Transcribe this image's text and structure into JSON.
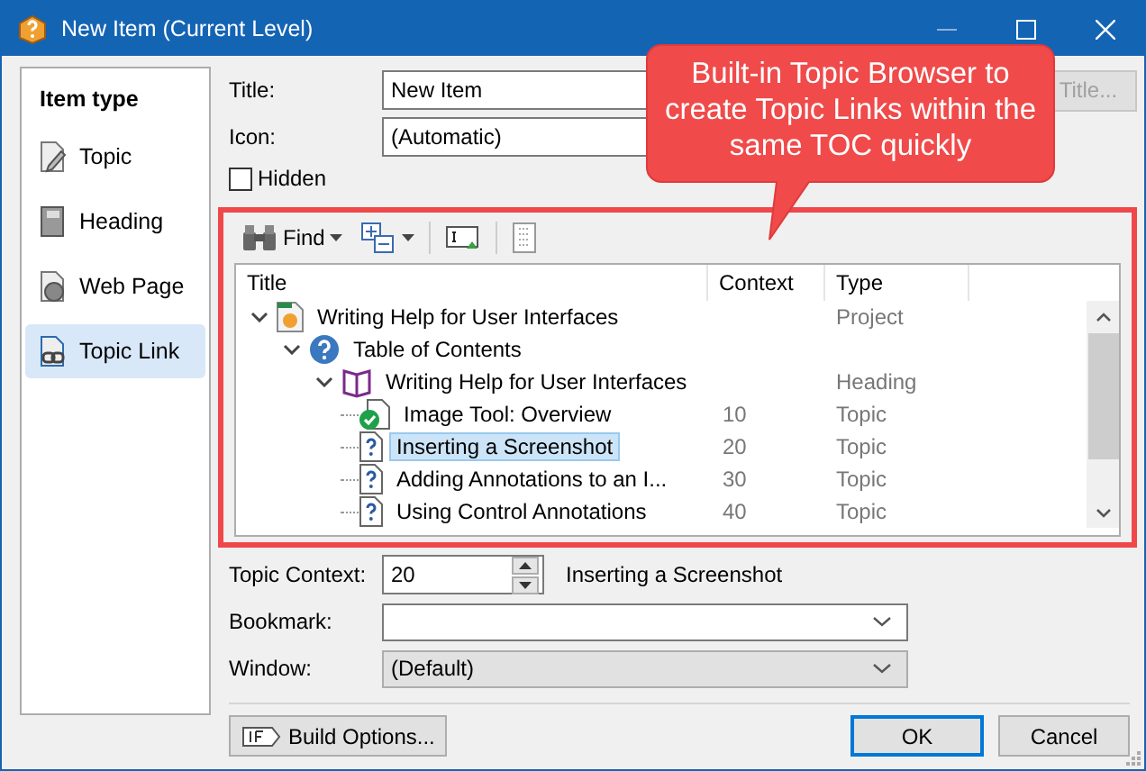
{
  "window": {
    "title": "New Item (Current Level)"
  },
  "item_types": {
    "heading": "Item type",
    "items": [
      {
        "label": "Topic",
        "kind": "topic",
        "selected": false
      },
      {
        "label": "Heading",
        "kind": "heading",
        "selected": false
      },
      {
        "label": "Web Page",
        "kind": "webpage",
        "selected": false
      },
      {
        "label": "Topic Link",
        "kind": "link",
        "selected": true
      }
    ]
  },
  "title_field": {
    "label": "Title:",
    "value": "New Item"
  },
  "title_button": {
    "label": "Title...",
    "disabled": true
  },
  "icon_field": {
    "label": "Icon:",
    "value": "(Automatic)"
  },
  "hidden_checkbox": {
    "label": "Hidden",
    "checked": false
  },
  "toolbar": {
    "find_label": "Find"
  },
  "tree": {
    "columns": [
      "Title",
      "Context",
      "Type"
    ],
    "rows": [
      {
        "title": "Writing Help for User Interfaces",
        "type": "Project",
        "kind": "project",
        "expanded": true,
        "selected": false,
        "children": [
          {
            "title": "Table of Contents",
            "kind": "contents",
            "expanded": true,
            "selected": false,
            "children": [
              {
                "title": "Writing Help for User Interfaces",
                "type": "Heading",
                "kind": "heading",
                "expanded": true,
                "selected": false,
                "children": [
                  {
                    "title": "Image Tool: Overview",
                    "context": "10",
                    "type": "Topic",
                    "kind": "reviewed",
                    "selected": false
                  },
                  {
                    "title": "Inserting a Screenshot",
                    "context": "20",
                    "type": "Topic",
                    "kind": "topic",
                    "selected": true
                  },
                  {
                    "title": "Adding Annotations to an I...",
                    "context": "30",
                    "type": "Topic",
                    "kind": "topic",
                    "selected": false
                  },
                  {
                    "title": "Using Control Annotations",
                    "context": "40",
                    "type": "Topic",
                    "kind": "topic",
                    "selected": false
                  }
                ]
              }
            ]
          }
        ]
      }
    ]
  },
  "topic_context": {
    "label": "Topic Context:",
    "value": "20",
    "topic_name": "Inserting a Screenshot"
  },
  "bookmark": {
    "label": "Bookmark:"
  },
  "window_field": {
    "label": "Window:",
    "value": "(Default)"
  },
  "buttons": {
    "build_options": "Build Options...",
    "ok": "OK",
    "cancel": "Cancel"
  },
  "callout": {
    "text": "Built-in Topic Browser to create Topic Links within the same TOC quickly"
  }
}
